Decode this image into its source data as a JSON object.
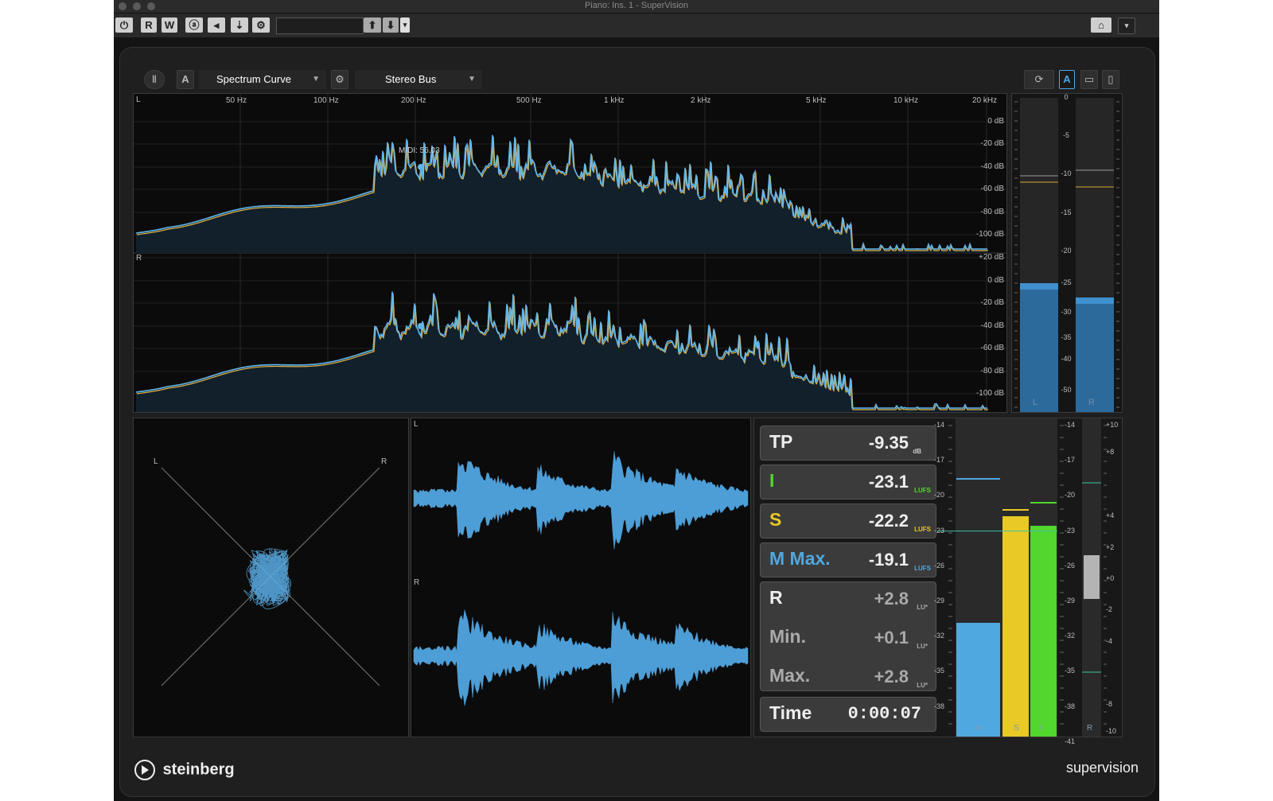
{
  "window": {
    "title": "Piano: Ins. 1 - SuperVision"
  },
  "host_toolbar": {
    "buttons": [
      "R",
      "W"
    ],
    "icons": [
      "power-icon",
      "automation-read",
      "automation-write",
      "monitor-icon",
      "left-arrow-icon",
      "connection-icon",
      "gear-icon",
      "camera-icon",
      "dropdown-arrow-icon"
    ]
  },
  "plugin_toolbar": {
    "pause_icon": "pause-icon",
    "a_label": "A",
    "module_select": "Spectrum Curve",
    "bus_select": "Stereo Bus",
    "right_a_label": "A",
    "icons": [
      "settings-icon",
      "sync-icon",
      "layout-bottom-icon",
      "layout-side-icon"
    ]
  },
  "spectrum": {
    "freq_labels": [
      "50 Hz",
      "100 Hz",
      "200 Hz",
      "500 Hz",
      "1 kHz",
      "2 kHz",
      "5 kHz",
      "10 kHz",
      "20 kHz"
    ],
    "db_labels_top": [
      "0 dB",
      "-20 dB",
      "-40 dB",
      "-60 dB",
      "-80 dB",
      "-100 dB"
    ],
    "db_labels_bottom": [
      "+20 dB",
      "0 dB",
      "-20 dB",
      "-40 dB",
      "-60 dB",
      "-80 dB",
      "-100 dB"
    ],
    "channel_L": "L",
    "channel_R": "R",
    "marker_label": "MIDI: 56.03",
    "colors": {
      "curve": "#5fb6ec",
      "peak": "#e3b54a"
    }
  },
  "level_meter": {
    "scale": [
      "0",
      "-5",
      "-10",
      "-15",
      "-20",
      "-25",
      "-30",
      "-35",
      "-40",
      "-50"
    ],
    "L": {
      "label": "L",
      "level_db": -25
    },
    "R": {
      "label": "R",
      "level_db": -27
    },
    "peak_db": -11
  },
  "vectorscope": {
    "label_L": "L",
    "label_R": "R"
  },
  "oscilloscope": {
    "label_L": "L",
    "label_R": "R"
  },
  "loudness": {
    "tp": {
      "label": "TP",
      "value": "-9.35",
      "unit": "dB"
    },
    "i": {
      "label": "I",
      "value": "-23.1",
      "unit": "LUFS"
    },
    "s": {
      "label": "S",
      "value": "-22.2",
      "unit": "LUFS"
    },
    "mmax": {
      "label": "M Max.",
      "value": "-19.1",
      "unit": "LUFS"
    },
    "r": {
      "label": "R",
      "value": "+2.8",
      "unit": "LU*"
    },
    "min": {
      "label": "Min.",
      "value": "+0.1",
      "unit": "LU*"
    },
    "max": {
      "label": "Max.",
      "value": "+2.8",
      "unit": "LU*"
    },
    "time": {
      "label": "Time",
      "value": "0:00:07"
    },
    "scale_left": [
      "-14",
      "-17",
      "-20",
      "-23",
      "-26",
      "-29",
      "-32",
      "-35",
      "-38"
    ],
    "scale_right": [
      "-14",
      "-17",
      "-20",
      "-23",
      "-26",
      "-29",
      "-32",
      "-35",
      "-38",
      "-41"
    ],
    "scale_r": [
      "+10",
      "+8",
      "+4",
      "+2",
      "+0",
      "-2",
      "-4",
      "-8",
      "-10"
    ],
    "bar_labels": [
      "M",
      "S",
      "I",
      "R"
    ],
    "colors": {
      "m": "#4fa8e0",
      "s": "#e8c926",
      "i": "#53d62d",
      "r": "#7a7a7a"
    }
  },
  "footer": {
    "brand": "steinberg",
    "product": "supervision"
  }
}
